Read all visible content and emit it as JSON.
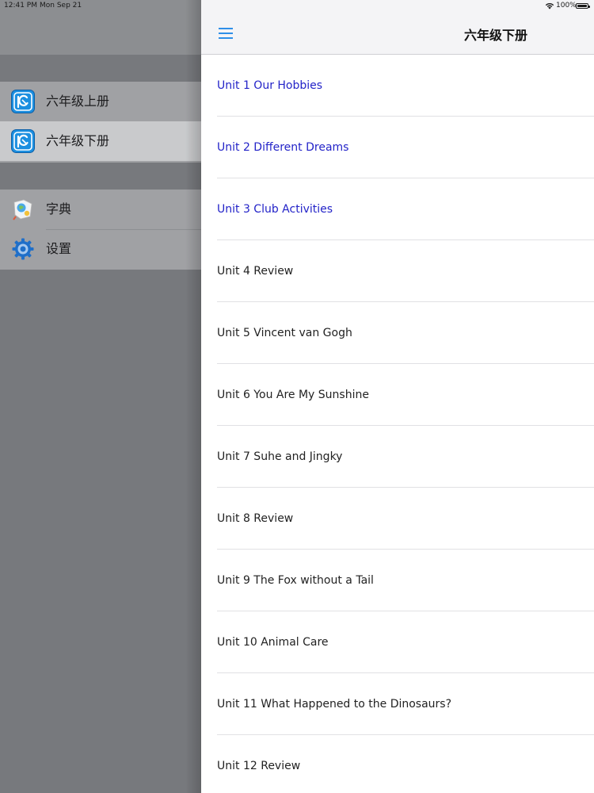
{
  "status_bar": {
    "time": "12:41 PM",
    "date": "Mon Sep 21",
    "battery": "100%"
  },
  "sidebar": {
    "book_items": [
      {
        "label": "六年级上册",
        "icon": "book-app-icon",
        "selected": false
      },
      {
        "label": "六年级下册",
        "icon": "book-app-icon",
        "selected": true
      }
    ],
    "tool_items": [
      {
        "label": "字典",
        "icon": "dictionary-icon"
      },
      {
        "label": "设置",
        "icon": "gear-icon"
      }
    ]
  },
  "navbar": {
    "title": "六年级下册"
  },
  "units": [
    {
      "label": "Unit 1 Our Hobbies",
      "highlight": true
    },
    {
      "label": "Unit 2 Different Dreams",
      "highlight": true
    },
    {
      "label": "Unit 3 Club Activities",
      "highlight": true
    },
    {
      "label": "Unit 4 Review",
      "highlight": false
    },
    {
      "label": "Unit 5 Vincent van Gogh",
      "highlight": false
    },
    {
      "label": "Unit 6 You Are My Sunshine",
      "highlight": false
    },
    {
      "label": "Unit 7 Suhe and Jingky",
      "highlight": false
    },
    {
      "label": "Unit 8 Review",
      "highlight": false
    },
    {
      "label": "Unit 9 The Fox without a Tail",
      "highlight": false
    },
    {
      "label": "Unit 10 Animal Care",
      "highlight": false
    },
    {
      "label": "Unit 11 What Happened to the Dinosaurs?",
      "highlight": false
    },
    {
      "label": "Unit 12 Review",
      "highlight": false
    }
  ],
  "colors": {
    "highlight_text": "#2323c8",
    "accent": "#2f8fe8"
  }
}
